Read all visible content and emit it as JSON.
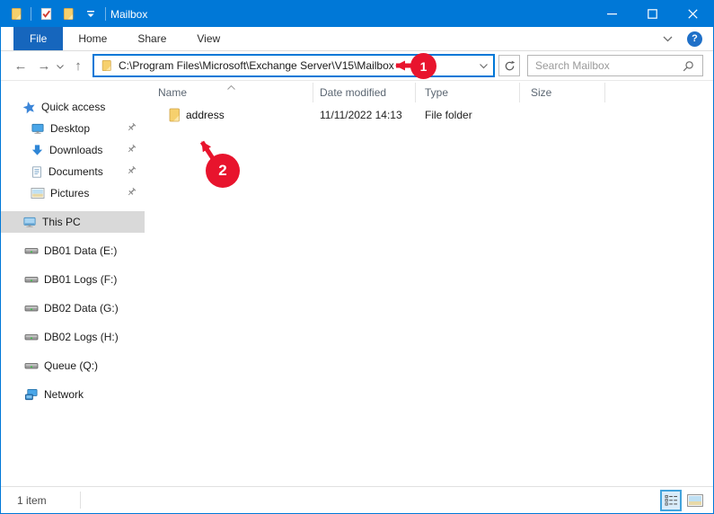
{
  "titlebar": {
    "title": "Mailbox",
    "quick_access_icons": [
      "folder-icon",
      "properties-check-icon",
      "new-folder-icon",
      "customize-toolbar-chevron"
    ]
  },
  "ribbon": {
    "tabs": [
      {
        "label": "File",
        "active": true
      },
      {
        "label": "Home",
        "active": false
      },
      {
        "label": "Share",
        "active": false
      },
      {
        "label": "View",
        "active": false
      }
    ],
    "help_label": "?"
  },
  "navbar": {
    "address_path": "C:\\Program Files\\Microsoft\\Exchange Server\\V15\\Mailbox",
    "search_placeholder": "Search Mailbox"
  },
  "sidebar": {
    "items": [
      {
        "label": "Quick access",
        "icon": "star-icon",
        "pinned": false
      },
      {
        "label": "Desktop",
        "icon": "desktop-icon",
        "pinned": true
      },
      {
        "label": "Downloads",
        "icon": "download-icon",
        "pinned": true
      },
      {
        "label": "Documents",
        "icon": "document-icon",
        "pinned": true
      },
      {
        "label": "Pictures",
        "icon": "picture-icon",
        "pinned": true
      },
      {
        "label": "This PC",
        "icon": "computer-icon",
        "selected": true
      },
      {
        "label": "DB01 Data (E:)",
        "icon": "drive-icon"
      },
      {
        "label": "DB01 Logs (F:)",
        "icon": "drive-icon"
      },
      {
        "label": "DB02 Data (G:)",
        "icon": "drive-icon"
      },
      {
        "label": "DB02 Logs (H:)",
        "icon": "drive-icon"
      },
      {
        "label": "Queue (Q:)",
        "icon": "drive-icon"
      },
      {
        "label": "Network",
        "icon": "network-icon"
      }
    ]
  },
  "filelist": {
    "columns": [
      "Name",
      "Date modified",
      "Type",
      "Size"
    ],
    "sort": {
      "column": "Name",
      "direction": "ascending"
    },
    "rows": [
      {
        "name": "address",
        "date_modified": "11/11/2022 14:13",
        "type": "File folder",
        "size": ""
      }
    ]
  },
  "statusbar": {
    "items_text": "1 item"
  },
  "annotations": {
    "step1": "1",
    "step2": "2"
  },
  "colors": {
    "titlebar_blue": "#0078d7",
    "file_tab_blue": "#1666bd",
    "annotation_red": "#e8142d",
    "selection_gray": "#d9d9d9",
    "folder_yellow": "#f6d06d"
  }
}
